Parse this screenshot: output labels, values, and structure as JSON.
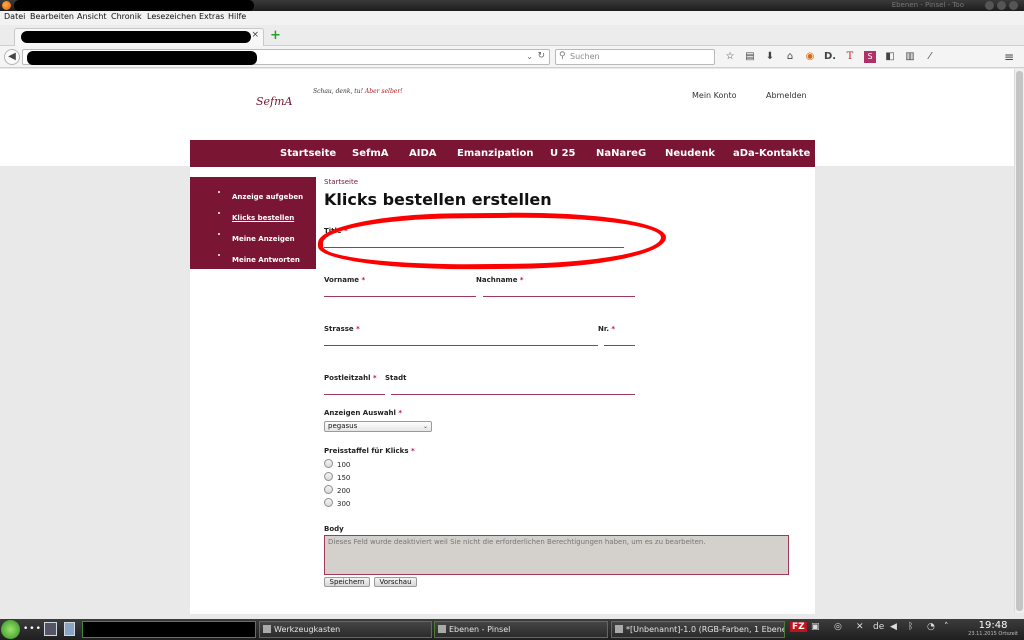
{
  "menubar": [
    "Datei",
    "Bearbeiten",
    "Ansicht",
    "Chronik",
    "Lesezeichen",
    "Extras",
    "Hilfe"
  ],
  "window": {
    "right_title": "Ebenen - Pinsel - Too"
  },
  "browser": {
    "tab_close": "×",
    "newtab": "+",
    "back": "◀",
    "url_dropdown": "⌄",
    "reload": "↻",
    "search_placeholder": "Suchen",
    "toolbar_icons": [
      "star-icon",
      "clipboard-icon",
      "download-icon",
      "home-icon",
      "addon-icon",
      "d-icon",
      "t-icon",
      "s-icon",
      "puzzle-icon",
      "trash-icon",
      "pin-icon"
    ],
    "toolbar_glyphs": [
      "☆",
      "▤",
      "⬇",
      "⌂",
      "◉",
      "D.",
      "T",
      "S",
      "◧",
      "▥",
      "⁄"
    ],
    "menu_glyph": "≡"
  },
  "site": {
    "logo_text": "SefmA",
    "slogan": "Schau, denk, tu! Aber selber!",
    "slogan_main": "Schau, denk, tu! ",
    "slogan_em": "Aber selber!",
    "top_links": [
      "Mein Konto",
      "Abmelden"
    ],
    "nav": [
      "Startseite",
      "SefmA",
      "AIDA",
      "Emanzipation",
      "U 25",
      "NaNareG",
      "Neudenk",
      "aDa-Kontakte"
    ],
    "sidebar": [
      "Anzeige aufgeben",
      "Klicks bestellen",
      "Meine Anzeigen",
      "Meine Antworten"
    ],
    "breadcrumb": "Startseite",
    "page_title": "Klicks bestellen erstellen"
  },
  "form": {
    "required_marker": "*",
    "title_label": "Title",
    "vorname_label": "Vorname",
    "nachname_label": "Nachname",
    "strasse_label": "Strasse",
    "nr_label": "Nr.",
    "plz_label": "Postleitzahl",
    "stadt_label": "Stadt",
    "anzeigen_label": "Anzeigen Auswahl",
    "anzeigen_value": "pegasus",
    "select_arrow": "⌄",
    "preis_label": "Preisstaffel für Klicks",
    "preis_options": [
      "100",
      "150",
      "200",
      "300"
    ],
    "body_label": "Body",
    "body_text": "Dieses Feld wurde deaktiviert weil Sie nicht die erforderlichen Berechtigungen haben, um es zu bearbeiten.",
    "save_label": "Speichern",
    "preview_label": "Vorschau"
  },
  "taskbar": {
    "dots": "•••",
    "windows": [
      "Werkzeugkasten",
      "Ebenen - Pinsel",
      "*[Unbenannt]-1.0 (RGB-Farben, 1 Ebene"
    ],
    "lang": "de",
    "time": "19:48",
    "date": "23.11.2015 Ortszeit"
  }
}
